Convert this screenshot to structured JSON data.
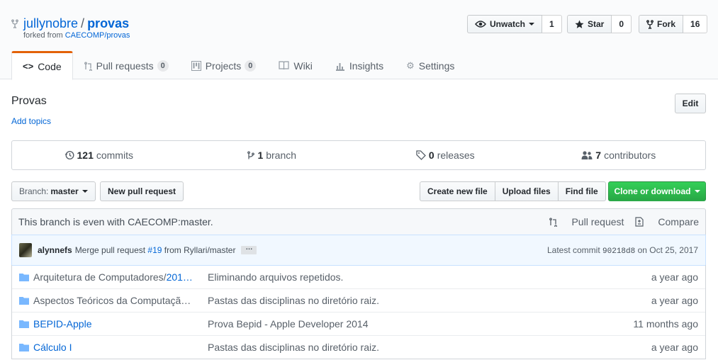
{
  "repo": {
    "owner": "jullynobre",
    "separator": "/",
    "name": "provas",
    "forked_prefix": "forked from",
    "forked_source": "CAECOMP/provas"
  },
  "actions": {
    "watch": {
      "label": "Unwatch",
      "count": "1"
    },
    "star": {
      "label": "Star",
      "count": "0"
    },
    "fork": {
      "label": "Fork",
      "count": "16"
    }
  },
  "tabs": [
    {
      "label": "Code",
      "icon": "code-icon",
      "selected": true
    },
    {
      "label": "Pull requests",
      "icon": "pull-request-icon",
      "counter": "0"
    },
    {
      "label": "Projects",
      "icon": "project-icon",
      "counter": "0"
    },
    {
      "label": "Wiki",
      "icon": "book-icon"
    },
    {
      "label": "Insights",
      "icon": "graph-icon"
    },
    {
      "label": "Settings",
      "icon": "gear-icon"
    }
  ],
  "description": "Provas",
  "add_topics": "Add topics",
  "edit_label": "Edit",
  "summary": {
    "commits": {
      "count": "121",
      "label": "commits"
    },
    "branches": {
      "count": "1",
      "label": "branch"
    },
    "releases": {
      "count": "0",
      "label": "releases"
    },
    "contributors": {
      "count": "7",
      "label": "contributors"
    }
  },
  "branch_select": {
    "prefix": "Branch:",
    "value": "master"
  },
  "new_pr_label": "New pull request",
  "file_nav": {
    "create": "Create new file",
    "upload": "Upload files",
    "find": "Find file"
  },
  "clone_label": "Clone or download",
  "branch_status": {
    "text": "This branch is even with CAECOMP:master.",
    "pull_request": "Pull request",
    "compare": "Compare"
  },
  "latest_commit": {
    "author": "alynnefs",
    "message_prefix": "Merge pull request",
    "pr_link": "#19",
    "message_suffix": "from Ryllari/master",
    "latest_label": "Latest commit",
    "sha": "90218d8",
    "date_label": "on Oct 25, 2017"
  },
  "files": [
    {
      "name": "Arquitetura de Computadores/",
      "name_link": "201…",
      "message": "Eliminando arquivos repetidos.",
      "age": "a year ago"
    },
    {
      "name": "Aspectos Teóricos da Computaçã…",
      "message": "Pastas das disciplinas no diretório raiz.",
      "age": "a year ago"
    },
    {
      "name_link": "BEPID-Apple",
      "message": "Prova Bepid - Apple Developer 2014",
      "age": "11 months ago"
    },
    {
      "name_link": "Cálculo I",
      "message": "Pastas das disciplinas no diretório raiz.",
      "age": "a year ago"
    }
  ]
}
